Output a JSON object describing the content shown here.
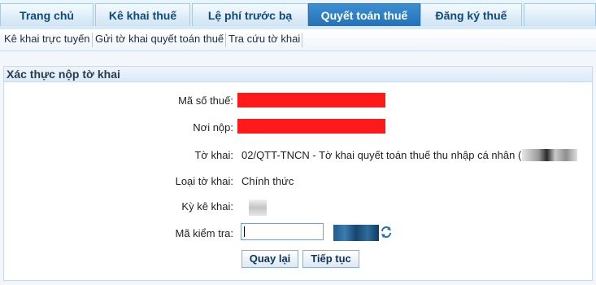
{
  "tabs": [
    {
      "label": "Trang chủ",
      "active": false
    },
    {
      "label": "Kê khai thuế",
      "active": false
    },
    {
      "label": "Lệ phí trước bạ",
      "active": false
    },
    {
      "label": "Quyết toán thuế",
      "active": true
    },
    {
      "label": "Đăng ký thuế",
      "active": false
    }
  ],
  "submenu": [
    {
      "label": "Kê khai trực tuyến"
    },
    {
      "label": "Gửi tờ khai quyết toán thuế"
    },
    {
      "label": "Tra cứu tờ khai"
    }
  ],
  "form": {
    "title": "Xác thực nộp tờ khai",
    "fields": {
      "ma_so_thue_label": "Mã số thuế:",
      "noi_nop_label": "Nơi nộp:",
      "to_khai_label": "Tờ khai:",
      "to_khai_value": "02/QTT-TNCN - Tờ khai quyết toán thuế thu nhập cá nhân (",
      "loai_to_khai_label": "Loại tờ khai:",
      "loai_to_khai_value": "Chính thức",
      "ky_ke_khai_label": "Kỳ kê khai:",
      "ma_kiem_tra_label": "Mã kiểm tra:"
    },
    "captcha_input": {
      "value": "",
      "placeholder": ""
    },
    "buttons": {
      "back": "Quay lại",
      "continue": "Tiếp tục"
    }
  },
  "colors": {
    "active_tab": "#2a77bd",
    "tab_text": "#0e4a7e",
    "redaction": "#ff1a1a",
    "panel_border": "#c8dbeb"
  }
}
